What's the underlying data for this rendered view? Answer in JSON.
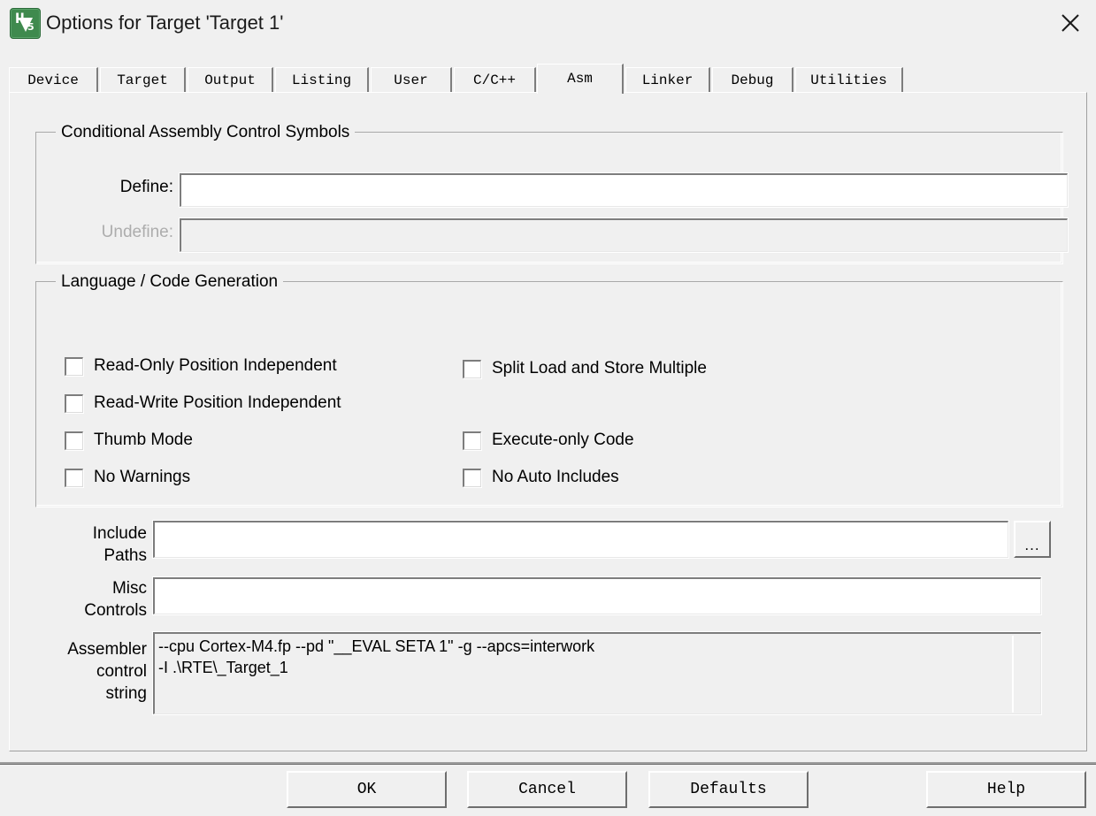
{
  "window": {
    "title": "Options for Target 'Target 1'",
    "icon": "uvision5-logo-icon",
    "close_label": "×",
    "bg_color": "#f0f0f0"
  },
  "tabs": [
    {
      "label": "Device",
      "active": false
    },
    {
      "label": "Target",
      "active": false
    },
    {
      "label": "Output",
      "active": false
    },
    {
      "label": "Listing",
      "active": false
    },
    {
      "label": "User",
      "active": false
    },
    {
      "label": "C/C++",
      "active": false
    },
    {
      "label": "Asm",
      "active": true
    },
    {
      "label": "Linker",
      "active": false
    },
    {
      "label": "Debug",
      "active": false
    },
    {
      "label": "Utilities",
      "active": false
    }
  ],
  "conditional_assembly": {
    "group_title": "Conditional Assembly Control Symbols",
    "define": {
      "label": "Define:",
      "value": "",
      "placeholder": "",
      "disabled": false
    },
    "undefine": {
      "label": "Undefine:",
      "value": "",
      "placeholder": "",
      "disabled": true
    }
  },
  "language_code_generation": {
    "group_title": "Language / Code Generation",
    "left_checkboxes": [
      {
        "label": "Read-Only Position Independent",
        "checked": false
      },
      {
        "label": "Read-Write Position Independent",
        "checked": false
      },
      {
        "label": "Thumb Mode",
        "checked": false
      },
      {
        "label": "No Warnings",
        "checked": false
      }
    ],
    "right_checkboxes": [
      {
        "label": "Split Load and Store Multiple",
        "checked": false
      },
      {
        "label": "Execute-only Code",
        "checked": false
      },
      {
        "label": "No Auto Includes",
        "checked": false
      }
    ]
  },
  "paths": {
    "include_paths": {
      "label_line1": "Include",
      "label_line2": "Paths",
      "value": "",
      "placeholder": ""
    },
    "browse_button": {
      "label": "...",
      "name": "browse-include-paths-button"
    },
    "misc_controls": {
      "label_line1": "Misc",
      "label_line2": "Controls",
      "value": "",
      "placeholder": ""
    },
    "assembler_control_string": {
      "label_line1": "Assembler",
      "label_line2": "control",
      "label_line3": "string",
      "value": "--cpu Cortex-M4.fp --pd \"__EVAL SETA 1\" -g --apcs=interwork\n-I .\\RTE\\_Target_1"
    }
  },
  "footer": {
    "ok_label": "OK",
    "cancel_label": "Cancel",
    "defaults_label": "Defaults",
    "help_label": "Help"
  }
}
